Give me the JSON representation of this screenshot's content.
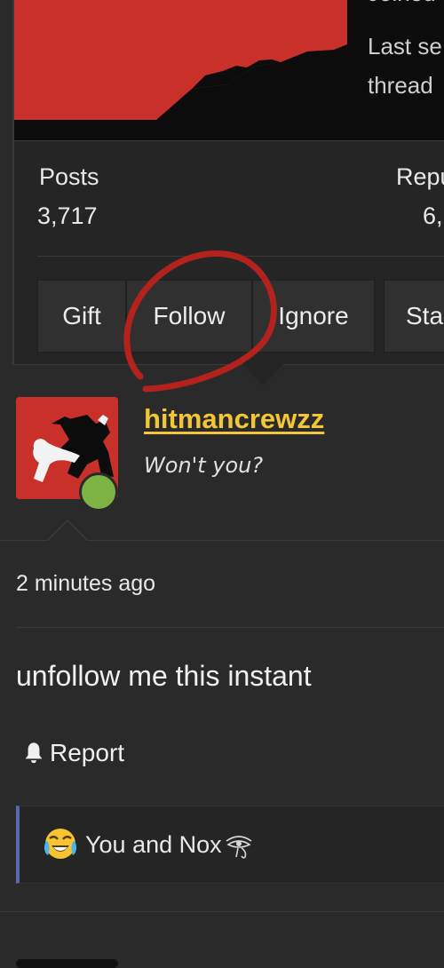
{
  "popup": {
    "banner_text": [
      "Joined",
      "Last se",
      "thread"
    ],
    "stats": [
      {
        "label": "Posts",
        "value": "3,717"
      },
      {
        "label": "Repu",
        "value": "6,"
      }
    ],
    "buttons": [
      "Gift",
      "Follow",
      "Ignore",
      "Sta"
    ]
  },
  "post": {
    "username": "hitmancrewzz",
    "user_title": "Won't you?",
    "timestamp": "2 minutes ago",
    "message": "unfollow me this instant",
    "report_label": "Report",
    "reactions_text": "You and Nox",
    "online_color": "#7cb342"
  },
  "colors": {
    "accent_username": "#f3c637",
    "annotation": "#b3221c",
    "banner_red": "#c9302a",
    "reaction_bar": "#5a68b0"
  },
  "icons": [
    "bell-icon",
    "crying-laughing-emoji-icon",
    "eye-of-horus-icon",
    "online-status-dot"
  ]
}
